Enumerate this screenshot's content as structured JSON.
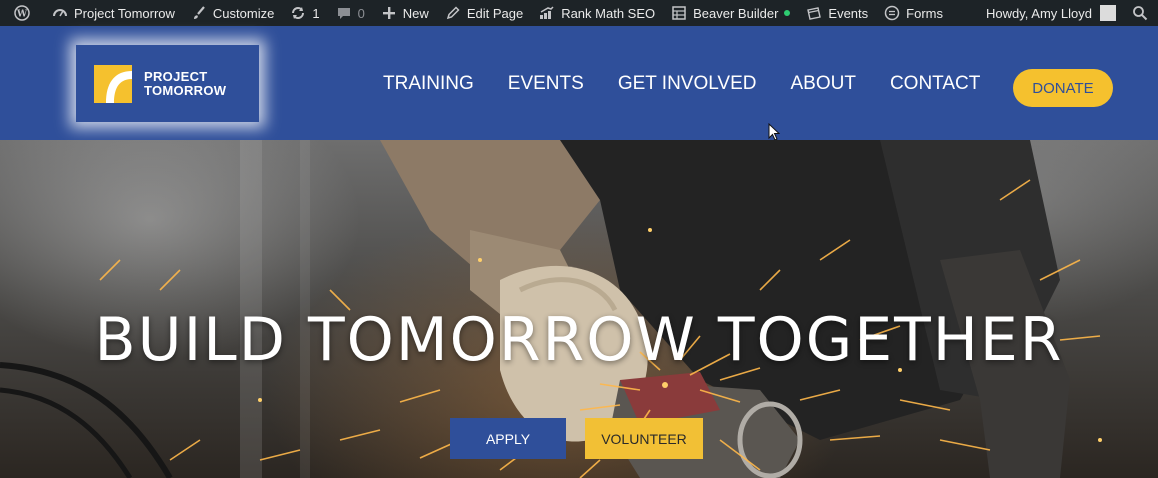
{
  "admin_bar": {
    "site_name": "Project Tomorrow",
    "customize": "Customize",
    "updates_count": "1",
    "comments_count": "0",
    "new": "New",
    "edit_page": "Edit Page",
    "rank_math": "Rank Math SEO",
    "beaver_builder": "Beaver Builder",
    "events": "Events",
    "forms": "Forms",
    "greeting": "Howdy, Amy Lloyd"
  },
  "header": {
    "logo_line1": "PROJECT",
    "logo_line2": "TOMORROW",
    "nav": [
      "TRAINING",
      "EVENTS",
      "GET INVOLVED",
      "ABOUT",
      "CONTACT"
    ],
    "donate": "DONATE"
  },
  "hero": {
    "title": "BUILD TOMORROW TOGETHER",
    "apply": "APPLY",
    "volunteer": "VOLUNTEER"
  },
  "colors": {
    "admin_bar_bg": "#1d2327",
    "brand_blue": "#2f4f9a",
    "brand_yellow": "#f5c12e",
    "status_dot_green": "#2ecc71"
  },
  "icons": [
    "wordpress-icon",
    "dashboard-icon",
    "brush-icon",
    "refresh-icon",
    "comment-icon",
    "plus-icon",
    "pencil-icon",
    "rank-math-icon",
    "table-icon",
    "calendar-icon",
    "forms-icon",
    "search-icon"
  ]
}
